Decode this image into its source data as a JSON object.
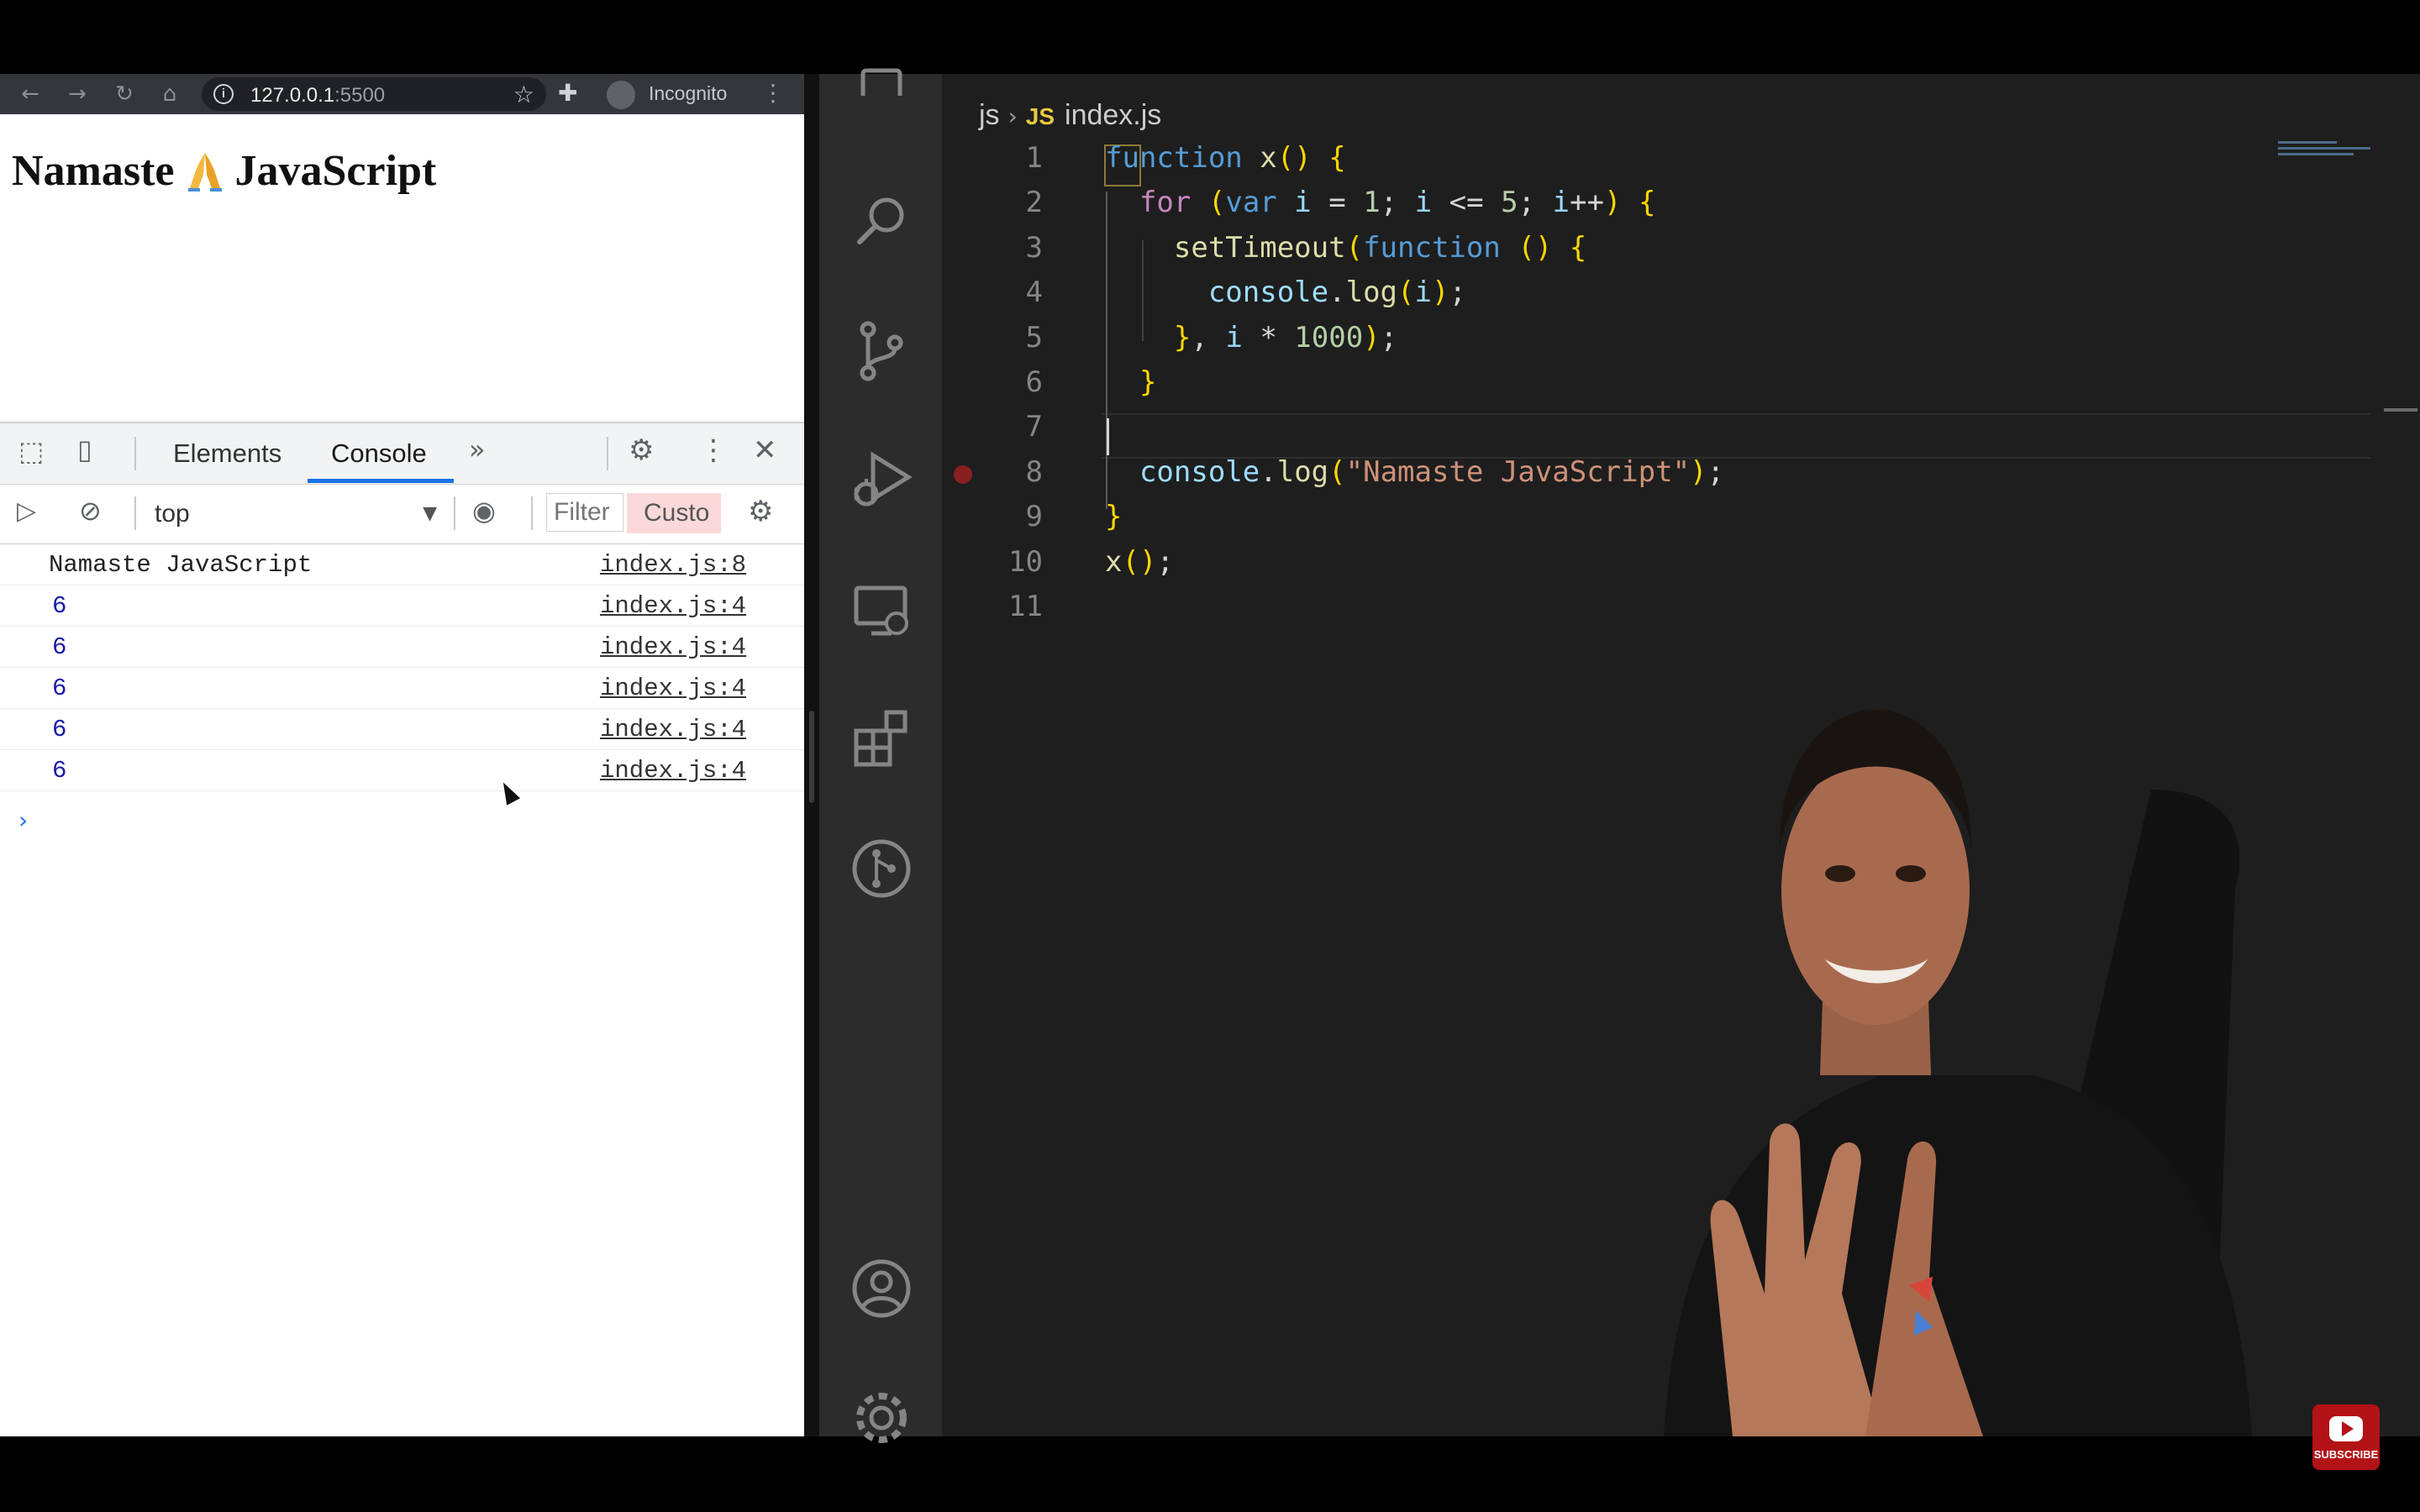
{
  "browser": {
    "url_host": "127.0.0.1",
    "url_port": ":5500",
    "incognito_label": "Incognito",
    "page_heading_left": "Namaste",
    "page_heading_right": "JavaScript",
    "heading_emoji_icon": "folded-hands-icon"
  },
  "devtools": {
    "tabs": [
      "Elements",
      "Console"
    ],
    "active_tab": "Console",
    "context": "top",
    "filter_placeholder": "Filter",
    "levels_label": "Custo",
    "messages": [
      {
        "text": "Namaste JavaScript",
        "source": "index.js:8"
      },
      {
        "text": "6",
        "source": "index.js:4"
      },
      {
        "text": "6",
        "source": "index.js:4"
      },
      {
        "text": "6",
        "source": "index.js:4"
      },
      {
        "text": "6",
        "source": "index.js:4"
      },
      {
        "text": "6",
        "source": "index.js:4"
      }
    ]
  },
  "editor": {
    "breadcrumb_folder": "js",
    "breadcrumb_badge": "JS",
    "breadcrumb_file": "index.js",
    "line_numbers": [
      "1",
      "2",
      "3",
      "4",
      "5",
      "6",
      "7",
      "8",
      "9",
      "10",
      "11"
    ],
    "code": [
      "function x() {",
      "  for (var i = 1; i <= 5; i++) {",
      "    setTimeout(function () {",
      "      console.log(i);",
      "    }, i * 1000);",
      "  }",
      "",
      "  console.log(\"Namaste JavaScript\");",
      "}",
      "x();",
      ""
    ]
  },
  "overlay": {
    "subscribe_label": "SUBSCRIBE"
  },
  "colors": {
    "keyword": "#569cd6",
    "function": "#dcdcaa",
    "string": "#ce9178",
    "number": "#b5cea8",
    "active_tab_accent": "#1a73e8"
  }
}
